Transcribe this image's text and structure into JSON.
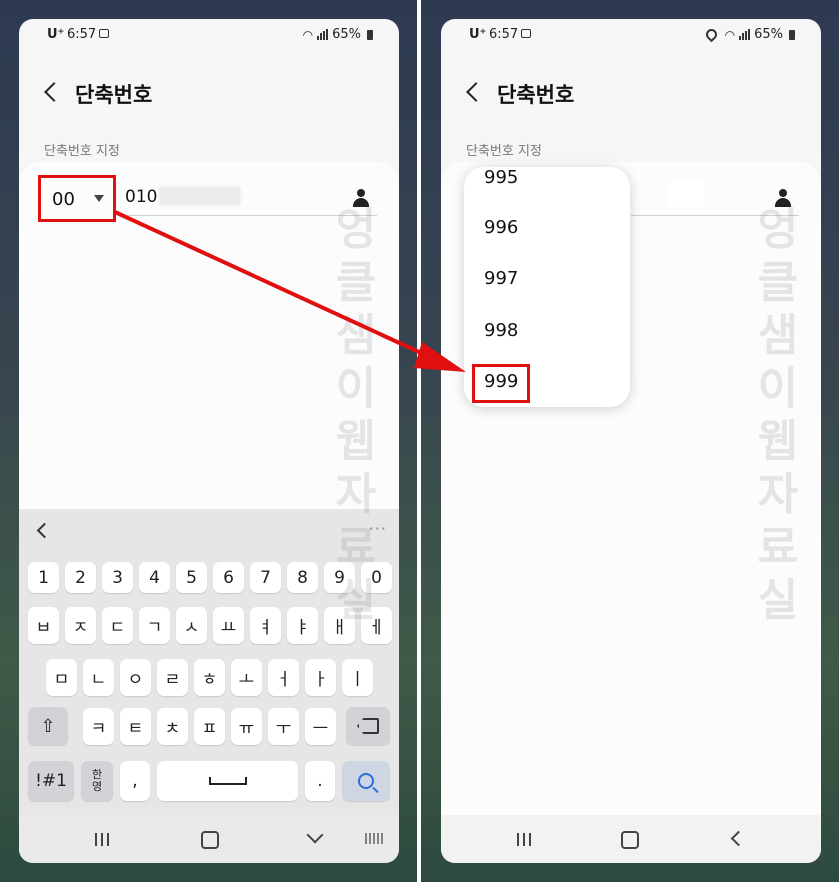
{
  "status_bar": {
    "carrier": "U⁺",
    "time": "6:57",
    "battery": "65%"
  },
  "header": {
    "title": "단축번호"
  },
  "section_label": "단축번호 지정",
  "left": {
    "speed_dial_code": "00",
    "phone_prefix": "010"
  },
  "picker_options": [
    "995",
    "996",
    "997",
    "998",
    "999"
  ],
  "keyboard": {
    "number_row": [
      "1",
      "2",
      "3",
      "4",
      "5",
      "6",
      "7",
      "8",
      "9",
      "0"
    ],
    "row1": [
      "ㅂ",
      "ㅈ",
      "ㄷ",
      "ㄱ",
      "ㅅ",
      "ㅛ",
      "ㅕ",
      "ㅑ",
      "ㅐ",
      "ㅔ"
    ],
    "row2": [
      "ㅁ",
      "ㄴ",
      "ㅇ",
      "ㄹ",
      "ㅎ",
      "ㅗ",
      "ㅓ",
      "ㅏ",
      "ㅣ"
    ],
    "row3": [
      "ㅋ",
      "ㅌ",
      "ㅊ",
      "ㅍ",
      "ㅠ",
      "ㅜ",
      "ㅡ"
    ],
    "symbols_key": "!#1",
    "lang_key_top": "한",
    "lang_key_bottom": "영",
    "comma_key": ",",
    "period_key": ".",
    "more_dots": "···"
  },
  "watermark": "엉클샘이웹자료실",
  "colors": {
    "highlight": "#e01010",
    "accent": "#2a6ed8"
  }
}
